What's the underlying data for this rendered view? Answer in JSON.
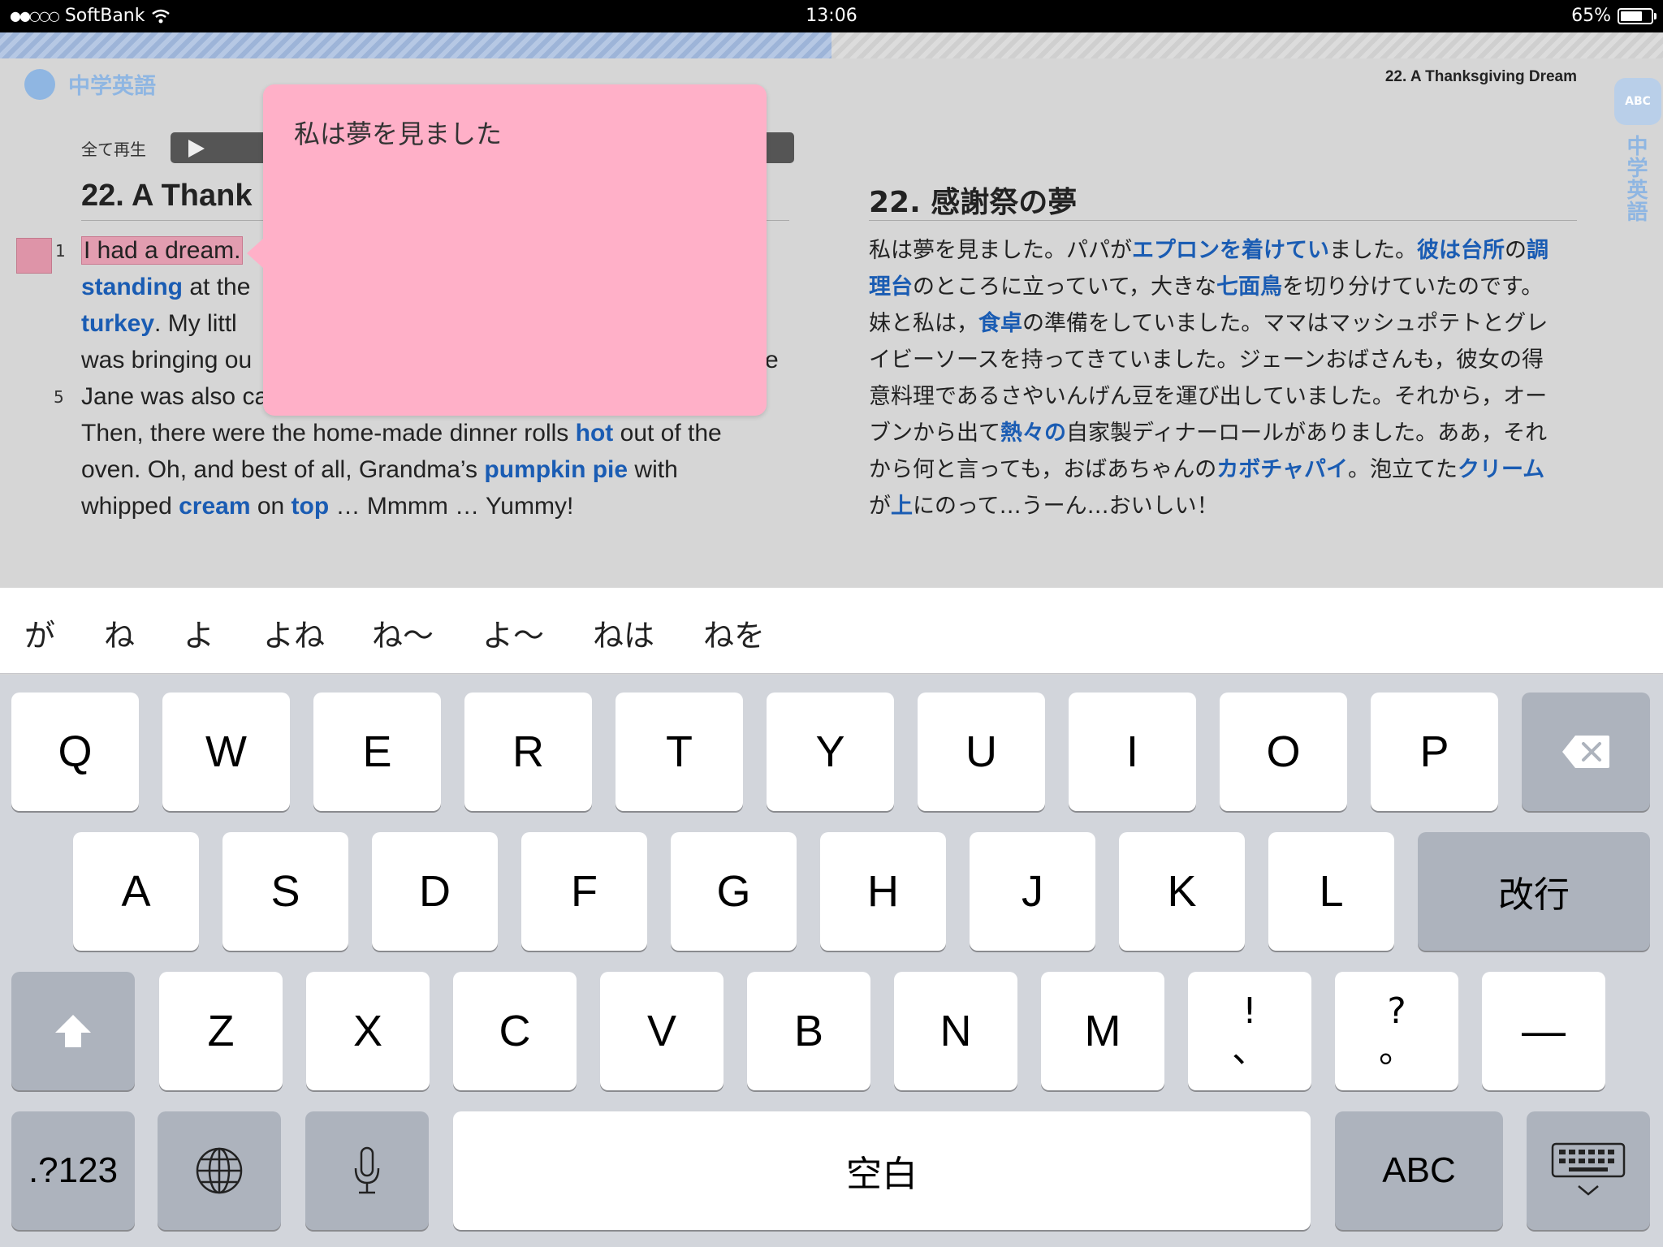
{
  "status_bar": {
    "carrier": "SoftBank",
    "signal": "●●○○○",
    "time": "13:06",
    "battery": "65%"
  },
  "progress": {
    "fraction": 0.5
  },
  "header": {
    "app_name": "中学英語",
    "lesson_title": "22. A Thanksgiving Dream",
    "side_tab_badge": "ABC",
    "side_tab_label": "中学英語"
  },
  "player": {
    "play_all_label": "全て再生"
  },
  "english": {
    "title": "22. A Thank",
    "line_numbers": [
      "1",
      "5"
    ],
    "lines": [
      [
        {
          "t": "I had a dream.",
          "hl": true
        }
      ],
      [
        {
          "t": "standing",
          "kw": true
        },
        {
          "t": " at the"
        }
      ],
      [
        {
          "t": "turkey",
          "kw": true
        },
        {
          "t": ".   My littl"
        }
      ],
      [
        {
          "t": "was bringing ou"
        }
      ],
      [
        {
          "t": "Jane was also ca"
        }
      ],
      [
        {
          "t": "Then, there were the home-made dinner rolls "
        },
        {
          "t": "hot",
          "kw": true
        },
        {
          "t": " out of the"
        }
      ],
      [
        {
          "t": "oven.   Oh, and best of all, Grandma’s "
        },
        {
          "t": "pumpkin pie",
          "kw": true
        },
        {
          "t": " with"
        }
      ],
      [
        {
          "t": "whipped "
        },
        {
          "t": "cream",
          "kw": true
        },
        {
          "t": " on "
        },
        {
          "t": "top",
          "kw": true
        },
        {
          "t": " … Mmmm … Yummy!"
        }
      ]
    ],
    "fragment_right": "e"
  },
  "japanese": {
    "title": "22. 感謝祭の夢",
    "lines": [
      [
        {
          "t": "私は夢を見ました。パパが"
        },
        {
          "t": "エプロンを着けてい",
          "kw": true
        },
        {
          "t": "ました。"
        },
        {
          "t": "彼は台所",
          "kw": true
        },
        {
          "t": "の"
        },
        {
          "t": "調",
          "kw": true
        }
      ],
      [
        {
          "t": "理台",
          "kw": true
        },
        {
          "t": "のところに立っていて，大きな"
        },
        {
          "t": "七面鳥",
          "kw": true
        },
        {
          "t": "を切り分けていたのです。"
        }
      ],
      [
        {
          "t": "妹と私は，"
        },
        {
          "t": "食卓",
          "kw": true
        },
        {
          "t": "の準備をしていました。ママはマッシュポテトとグレ"
        }
      ],
      [
        {
          "t": "イビーソースを持ってきていました。ジェーンおばさんも，彼女の得"
        }
      ],
      [
        {
          "t": "意料理であるさやいんげん豆を運び出していました。それから，オー"
        }
      ],
      [
        {
          "t": "ブンから出て"
        },
        {
          "t": "熱々の",
          "kw": true
        },
        {
          "t": "自家製ディナーロールがありました。ああ，それ"
        }
      ],
      [
        {
          "t": "から何と言っても，おばあちゃんの"
        },
        {
          "t": "カボチャパイ",
          "kw": true
        },
        {
          "t": "。泡立てた"
        },
        {
          "t": "クリーム",
          "kw": true
        }
      ],
      [
        {
          "t": "が"
        },
        {
          "t": "上",
          "kw": true
        },
        {
          "t": "にのって…うーん…おいしい！"
        }
      ]
    ]
  },
  "popover": {
    "note_text": "私は夢を見ました"
  },
  "suggestions": [
    "が",
    "ね",
    "よ",
    "よね",
    "ね〜",
    "よ〜",
    "ねは",
    "ねを"
  ],
  "keyboard": {
    "row1": [
      "Q",
      "W",
      "E",
      "R",
      "T",
      "Y",
      "U",
      "I",
      "O",
      "P"
    ],
    "row2": [
      "A",
      "S",
      "D",
      "F",
      "G",
      "H",
      "J",
      "K",
      "L"
    ],
    "return_label": "改行",
    "row3": [
      "Z",
      "X",
      "C",
      "V",
      "B",
      "N",
      "M"
    ],
    "punct1": [
      "!",
      "、"
    ],
    "punct2": [
      "?",
      "。"
    ],
    "dash": "—",
    "numbers_label": ".?123",
    "space_label": "空白",
    "abc_label": "ABC"
  },
  "colors": {
    "keyword": "#1a5cb3",
    "highlight": "#e29db0",
    "popover": "#ffb0c8",
    "brand": "#8fb6e2"
  }
}
